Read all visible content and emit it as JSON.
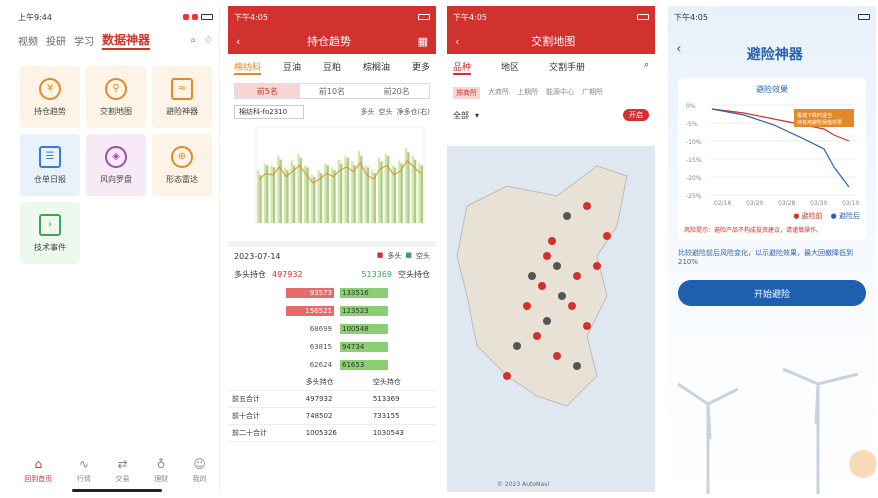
{
  "p1": {
    "status_time": "上午9:44",
    "nav": [
      "视频",
      "投研",
      "学习"
    ],
    "nav_active": "数据神器",
    "tiles": [
      {
        "label": "持仓趋势",
        "icon": "coin-icon",
        "bg": "#fdf3e6"
      },
      {
        "label": "交割地图",
        "icon": "map-pin-icon",
        "bg": "#fdf3e6"
      },
      {
        "label": "避险神器",
        "icon": "wave-icon",
        "bg": "#fdf3e6"
      },
      {
        "label": "仓单日报",
        "icon": "clipboard-icon",
        "bg": "#e9f1fb"
      },
      {
        "label": "风向罗盘",
        "icon": "compass-icon",
        "bg": "#f7eaf6"
      },
      {
        "label": "形态雷达",
        "icon": "radar-icon",
        "bg": "#fdf3e6"
      },
      {
        "label": "技术事件",
        "icon": "terminal-icon",
        "bg": "#eef8ef"
      }
    ],
    "bottom": [
      "回到首页",
      "行情",
      "交易",
      "理财",
      "我的"
    ]
  },
  "p2": {
    "status_time": "下午4:05",
    "title": "持仓趋势",
    "tabs": [
      "棉纺科",
      "豆油",
      "豆粕",
      "棕榈油",
      "更多"
    ],
    "seg": [
      "前5名",
      "前10名",
      "前20名"
    ],
    "contract": "棉纺科-fo2310",
    "legend": [
      "多头",
      "空头",
      "净多仓(右)"
    ],
    "chart_bars_long": [
      0.55,
      0.62,
      0.6,
      0.7,
      0.58,
      0.65,
      0.72,
      0.6,
      0.5,
      0.55,
      0.62,
      0.58,
      0.66,
      0.7,
      0.64,
      0.75,
      0.6,
      0.55,
      0.68,
      0.72,
      0.6,
      0.65,
      0.78,
      0.7,
      0.62
    ],
    "chart_bars_short": [
      0.5,
      0.6,
      0.58,
      0.66,
      0.55,
      0.6,
      0.68,
      0.58,
      0.48,
      0.52,
      0.6,
      0.55,
      0.62,
      0.68,
      0.6,
      0.7,
      0.58,
      0.52,
      0.64,
      0.7,
      0.58,
      0.62,
      0.74,
      0.66,
      0.6
    ],
    "date": "2023-07-14",
    "long_total_label": "多头持仓",
    "long_total": "497932",
    "short_total": "513369",
    "short_total_label": "空头持仓",
    "rows": [
      {
        "l": "93573",
        "r": "133516"
      },
      {
        "l": "156521",
        "r": "123523"
      },
      {
        "l": "68699",
        "r": "100548"
      },
      {
        "l": "63815",
        "r": "94734"
      },
      {
        "l": "62624",
        "r": "61653"
      }
    ],
    "summary_head": [
      "多头持仓",
      "空头持仓"
    ],
    "summary": [
      {
        "k": "前五合计",
        "a": "497932",
        "b": "513369"
      },
      {
        "k": "前十合计",
        "a": "748502",
        "b": "733155"
      },
      {
        "k": "前二十合计",
        "a": "1005326",
        "b": "1030543"
      }
    ]
  },
  "p3": {
    "status_time": "下午4:05",
    "title": "交割地图",
    "tabs": [
      "品种",
      "地区",
      "交割手册"
    ],
    "subtabs": [
      "郑商所",
      "大商所",
      "上期所",
      "能源中心",
      "广期所"
    ],
    "filter": "全部",
    "toggle": "开启",
    "credit": "© 2023 AutoNavi"
  },
  "p4": {
    "status_time": "下午4:05",
    "title": "避险神器",
    "chart_title": "避险效果",
    "chart_note": "极端下跌时适当\n持有用避险保值效果",
    "ytick": [
      "0%",
      "-5%",
      "-10%",
      "-15%",
      "-20%",
      "-25%"
    ],
    "xtick": [
      "02/16",
      "03/20",
      "03/28",
      "03/30",
      "03/10"
    ],
    "legend": [
      "避险前",
      "避险后"
    ],
    "risk_text": "风险提示：避险产品不构成投资建议，请谨慎操作。",
    "desc": "比较避险前后风险变化，以示避险效果，最大回撤降低到210%",
    "button": "开始避险"
  }
}
